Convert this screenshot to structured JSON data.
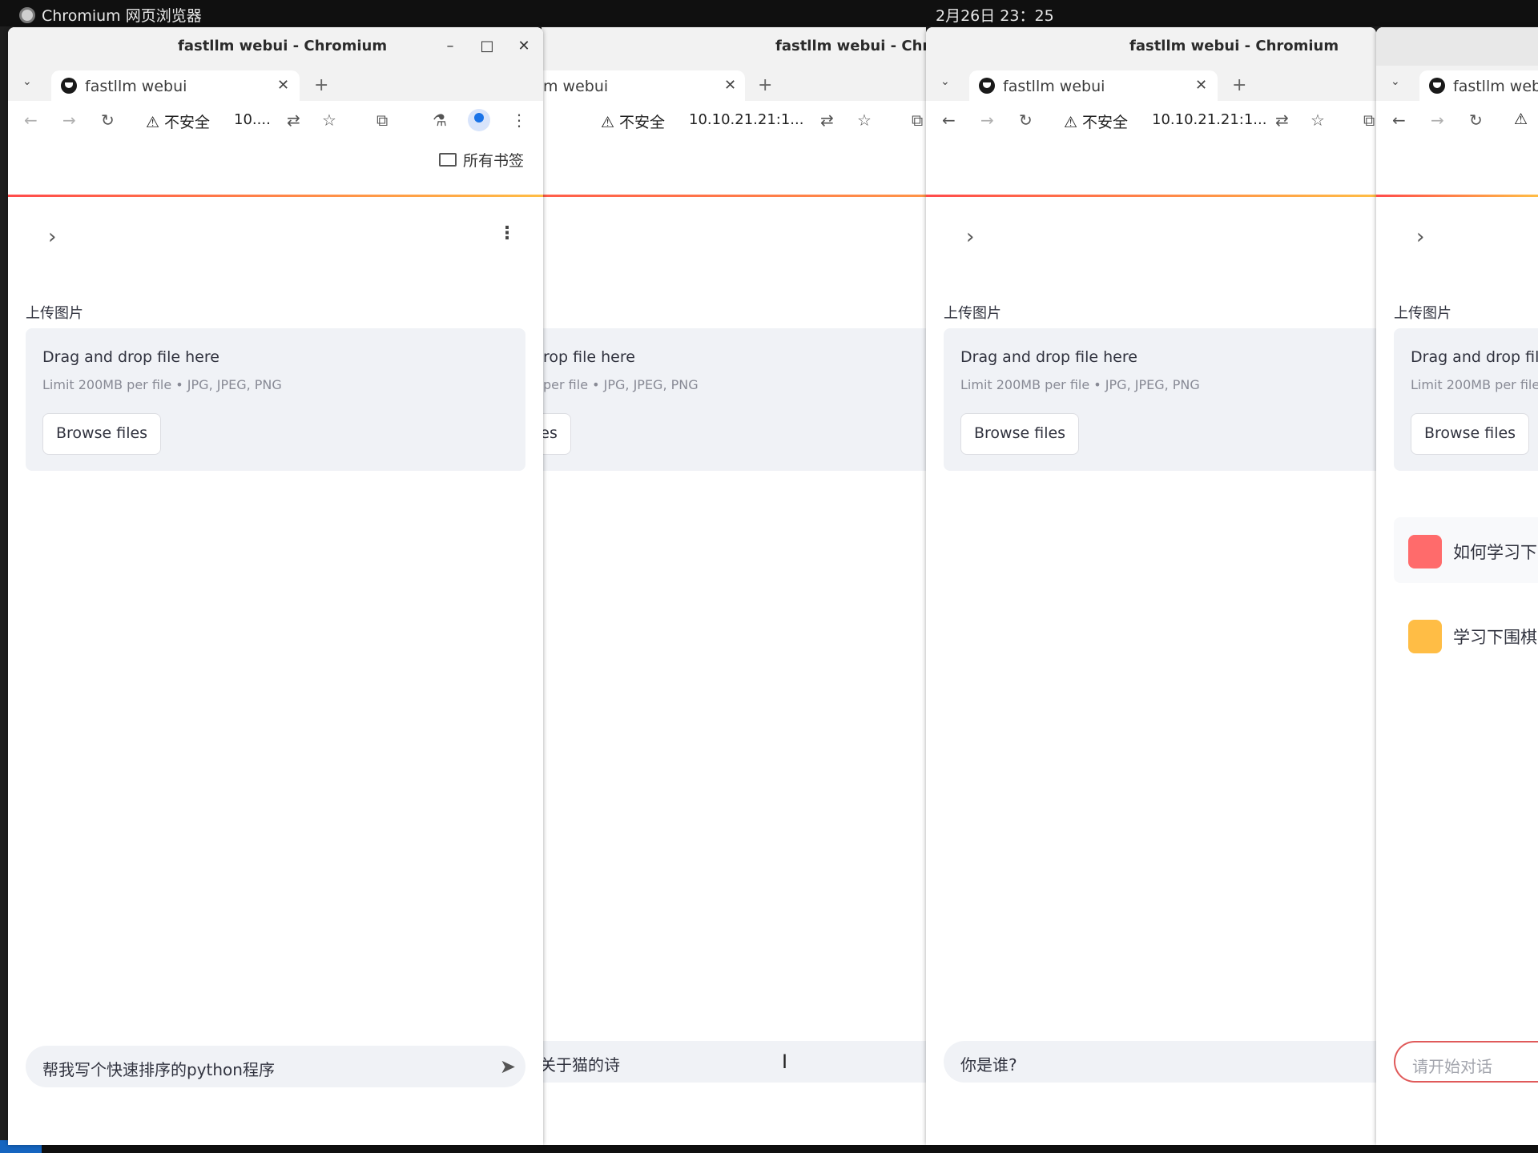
{
  "os": {
    "app_name": "Chromium 网页浏览器",
    "clock": "2月26日 23：25"
  },
  "windows": [
    {
      "title": "fastllm webui - Chromium",
      "tab_title": "fastllm webui",
      "security": "不安全",
      "url": "10....",
      "bookmarks_label": "所有书签",
      "upload_label": "上传图片",
      "drop_title": "Drag and drop file here",
      "drop_limit": "Limit 200MB per file • JPG, JPEG, PNG",
      "browse": "Browse files",
      "chat_input": "帮我写个快速排序的python程序"
    },
    {
      "title": "fastllm webui - Chromium",
      "tab_title": "m webui",
      "security": "不安全",
      "url": "10.10.21.21:1...",
      "drop_title": "rop file here",
      "drop_limit": "per file • JPG, JPEG, PNG",
      "browse": "les",
      "chat_input": "关于猫的诗"
    },
    {
      "title": "fastllm webui - Chromium",
      "tab_title": "fastllm webui",
      "security": "不安全",
      "url": "10.10.21.21:1...",
      "upload_label": "上传图片",
      "drop_title": "Drag and drop file here",
      "drop_limit": "Limit 200MB per file • JPG, JPEG, PNG",
      "browse": "Browse files",
      "chat_input": "你是谁?"
    },
    {
      "tab_title": "fastllm web",
      "upload_label": "上传图片",
      "drop_title": "Drag and drop file",
      "drop_limit": "Limit 200MB per file",
      "browse": "Browse files",
      "suggestions": [
        {
          "text": "如何学习下",
          "color": "#ff6b6b"
        },
        {
          "text": "学习下围棋",
          "color": "#ffbd45"
        }
      ],
      "chat_placeholder": "请开始对话"
    }
  ],
  "icons": {
    "back": "back-arrow-icon",
    "forward": "forward-arrow-icon",
    "reload": "reload-icon",
    "translate": "translate-icon",
    "bookmark_star": "star-icon",
    "extensions": "extensions-icon",
    "labs": "flask-icon",
    "send": "send-icon"
  }
}
